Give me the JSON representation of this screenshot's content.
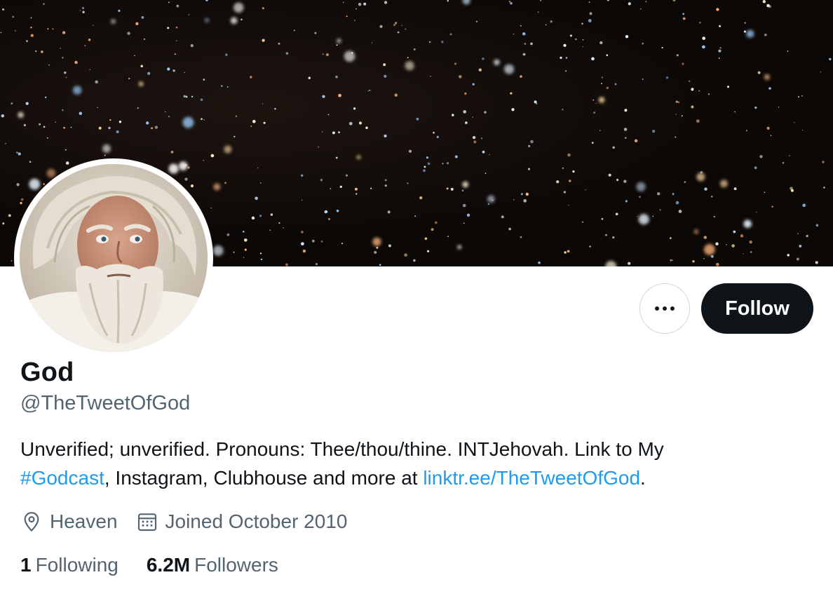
{
  "profile": {
    "display_name": "God",
    "handle": "@TheTweetOfGod",
    "bio": {
      "line_1": "Unverified; unverified. Pronouns: Thee/thou/thine. INTJehovah. Link to My",
      "hashtag": "#Godcast",
      "middle": ", Instagram, Clubhouse and more at ",
      "link": "linktr.ee/TheTweetOfGod",
      "end": "."
    },
    "location": "Heaven",
    "joined": "Joined October 2010",
    "location_icon": "location-pin-icon",
    "calendar_icon": "calendar-icon"
  },
  "actions": {
    "more_icon": "more-horizontal-icon",
    "follow_label": "Follow"
  },
  "stats": {
    "following_count": "1",
    "following_label": "Following",
    "followers_count": "6.2M",
    "followers_label": "Followers"
  },
  "colors": {
    "text_primary": "#0f1419",
    "text_secondary": "#536471",
    "link": "#1d9bf0",
    "follow_button_bg": "#0f1419",
    "banner_bg": "#0a0705"
  }
}
